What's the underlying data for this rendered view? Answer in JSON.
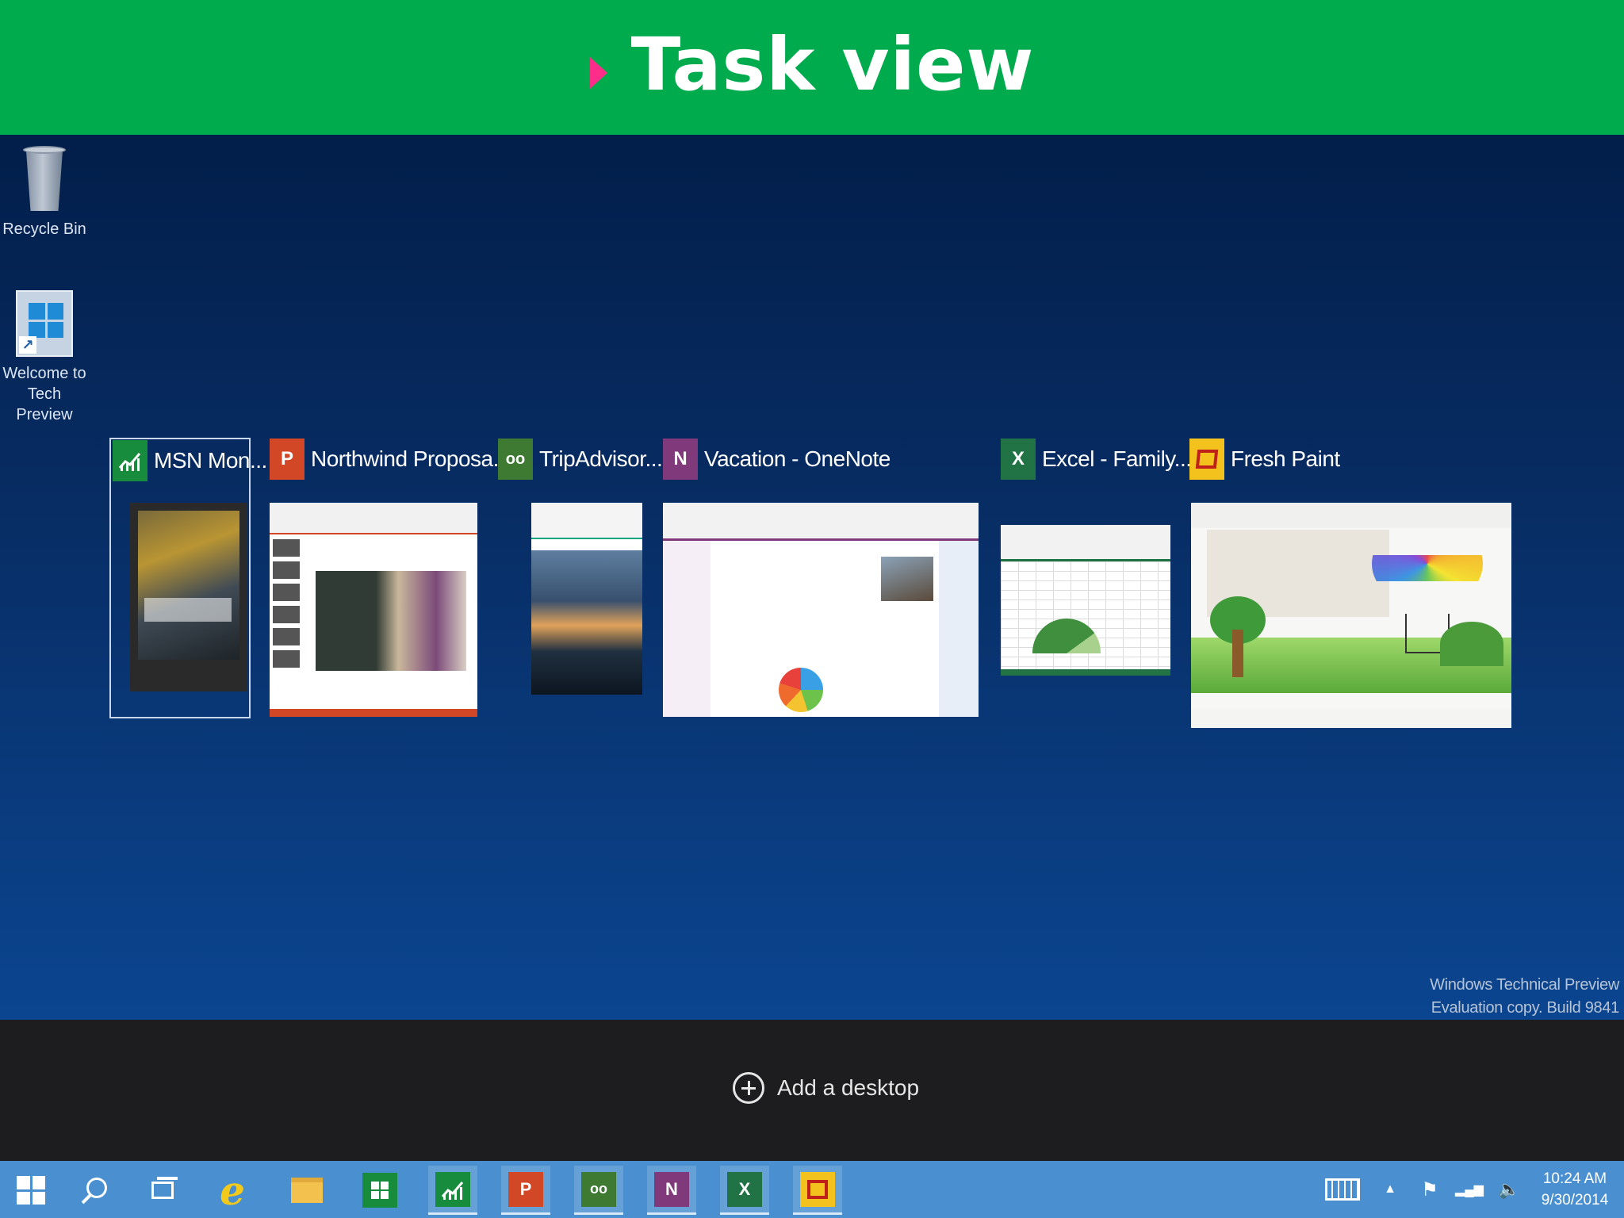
{
  "slide": {
    "title": "Task view",
    "accent_color": "#00ab4e",
    "bullet_color": "#ff2d8a"
  },
  "desktop_icons": [
    {
      "label": "Recycle Bin",
      "icon": "recycle-bin-icon"
    },
    {
      "label_line1": "Welcome to",
      "label_line2": "Tech Preview",
      "icon": "windows-shortcut-icon"
    }
  ],
  "task_windows": [
    {
      "title": "MSN Mon...",
      "icon_text": "",
      "icon": "msn-money-icon",
      "icon_color": "#168c3c",
      "selected": true
    },
    {
      "title": "Northwind Proposa...",
      "icon_text": "P",
      "icon": "powerpoint-icon",
      "icon_color": "#d24726"
    },
    {
      "title": "TripAdvisor...",
      "icon_text": "oo",
      "icon": "tripadvisor-icon",
      "icon_color": "#3f7a33"
    },
    {
      "title": "Vacation - OneNote",
      "icon_text": "N",
      "icon": "onenote-icon",
      "icon_color": "#80397b"
    },
    {
      "title": "Excel - Family...",
      "icon_text": "X",
      "icon": "excel-icon",
      "icon_color": "#217346"
    },
    {
      "title": "Fresh Paint",
      "icon_text": "",
      "icon": "fresh-paint-icon",
      "icon_color": "#f4c21c"
    }
  ],
  "watermark": {
    "line1": "Windows Technical Preview",
    "line2": "Evaluation copy. Build 9841"
  },
  "add_desktop": {
    "label": "Add a desktop"
  },
  "taskbar": {
    "color": "#4a90d0",
    "items": [
      {
        "name": "start",
        "icon": "windows-start-icon"
      },
      {
        "name": "search",
        "icon": "search-icon"
      },
      {
        "name": "task-view",
        "icon": "task-view-icon"
      },
      {
        "name": "internet-explorer",
        "icon": "internet-explorer-icon",
        "text": "e"
      },
      {
        "name": "file-explorer",
        "icon": "folder-icon"
      },
      {
        "name": "store",
        "icon": "store-icon"
      },
      {
        "name": "msn-money",
        "icon": "msn-money-icon"
      },
      {
        "name": "powerpoint",
        "icon": "powerpoint-icon",
        "text": "P"
      },
      {
        "name": "tripadvisor",
        "icon": "tripadvisor-icon",
        "text": "oo"
      },
      {
        "name": "onenote",
        "icon": "onenote-icon",
        "text": "N"
      },
      {
        "name": "excel",
        "icon": "excel-icon",
        "text": "X"
      },
      {
        "name": "fresh-paint",
        "icon": "fresh-paint-icon"
      }
    ],
    "tray": {
      "up_arrow": "▲",
      "flag": "⚑",
      "signal": "▂▄▆",
      "volume": "🔈",
      "time": "10:24 AM",
      "date": "9/30/2014"
    }
  }
}
